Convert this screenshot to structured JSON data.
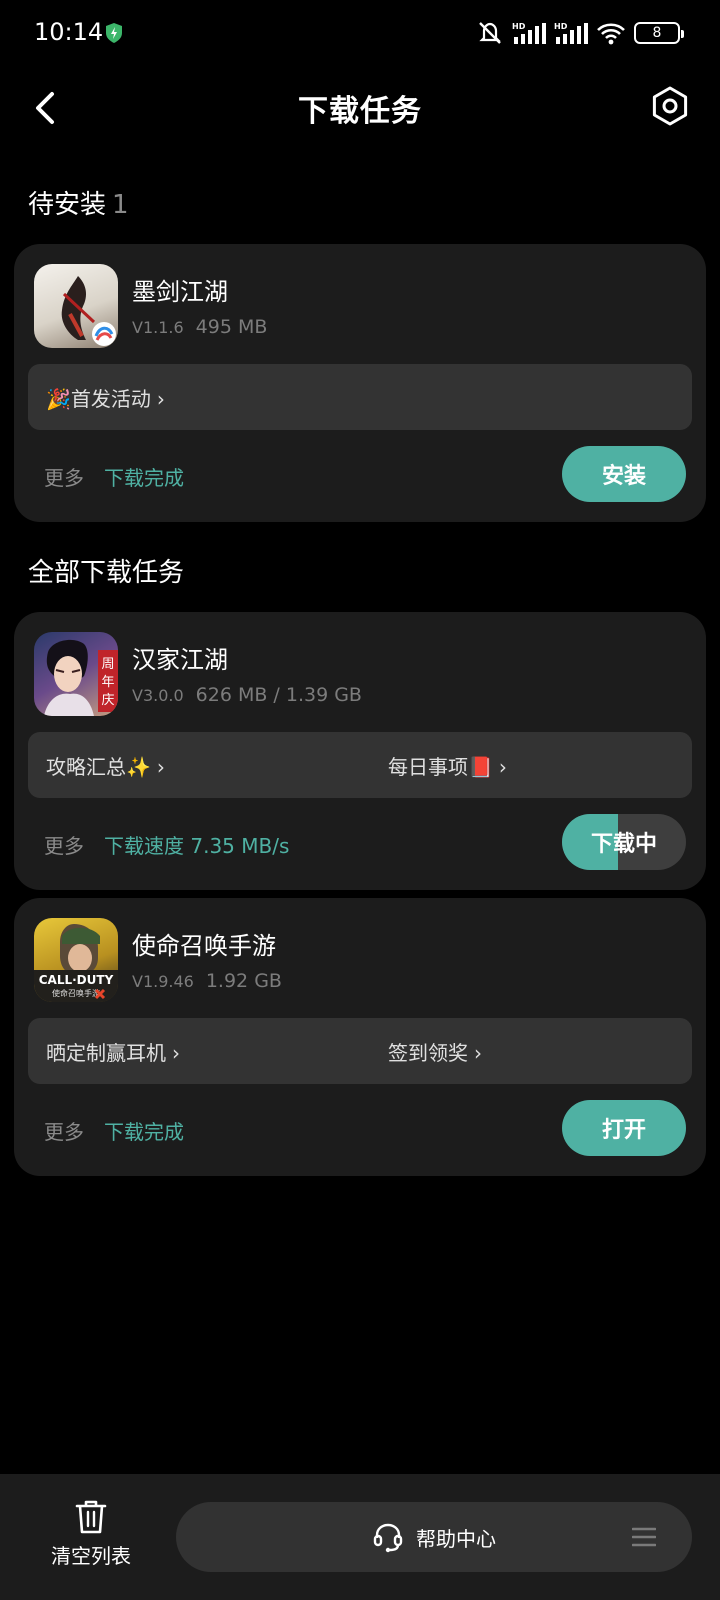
{
  "status_bar": {
    "time": "10:14",
    "battery": "8"
  },
  "header": {
    "title": "下载任务"
  },
  "pending": {
    "section_title": "待安装",
    "count": "1",
    "card": {
      "name": "墨剑江湖",
      "version": "V1.1.6",
      "size": "495 MB",
      "promos": [
        "🎉首发活动"
      ],
      "more": "更多",
      "status": "下载完成",
      "action": "安装"
    }
  },
  "all": {
    "section_title": "全部下载任务",
    "cards": [
      {
        "name": "汉家江湖",
        "version": "V3.0.0",
        "size": "626 MB / 1.39 GB",
        "promos": [
          "攻略汇总✨",
          "每日事项📕"
        ],
        "more": "更多",
        "status": "下载速度 7.35 MB/s",
        "action": "下载中",
        "progress": 0.45
      },
      {
        "name": "使命召唤手游",
        "version": "V1.9.46",
        "size": "1.92 GB",
        "promos": [
          "晒定制赢耳机",
          "签到领奖"
        ],
        "more": "更多",
        "status": "下载完成",
        "action": "打开"
      }
    ]
  },
  "bottom_bar": {
    "clear_label": "清空列表",
    "help_label": "帮助中心"
  },
  "colors": {
    "accent": "#4fb1a3",
    "card": "#1c1c1c",
    "promo_bg": "#333333"
  },
  "icons": [
    "shield-icon",
    "mute-icon",
    "signal-icon",
    "wifi-icon",
    "back-icon",
    "settings-icon",
    "trash-icon",
    "headset-icon",
    "menu-icon"
  ]
}
